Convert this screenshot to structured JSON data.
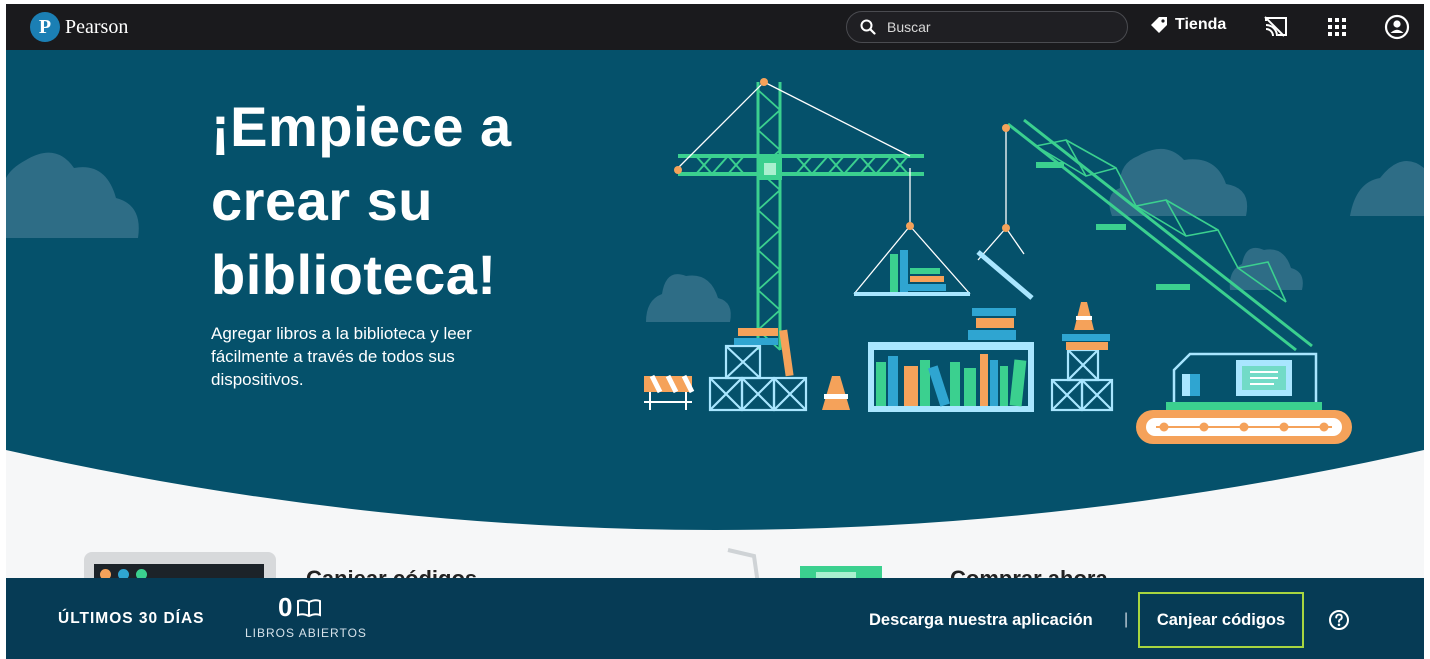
{
  "brand": {
    "logo_letter": "P",
    "name": "Pearson"
  },
  "header": {
    "search_placeholder": "Buscar",
    "store_label": "Tienda",
    "icons": [
      "search-icon",
      "tag-icon",
      "cast-off-icon",
      "apps-grid-icon",
      "account-icon"
    ]
  },
  "hero": {
    "title": "¡Empiece a crear su biblioteca!",
    "subtitle": "Agregar libros a la biblioteca y leer fácilmente a través de todos sus dispositivos."
  },
  "cards": [
    {
      "title": "Canjear códigos"
    },
    {
      "title": "Comprar ahora"
    }
  ],
  "footer": {
    "period_label": "ÚLTIMOS 30 DÍAS",
    "books_open_count": "0",
    "books_open_label": "LIBROS ABIERTOS",
    "app_link": "Descarga nuestra aplicación",
    "separator": "|",
    "redeem_link": "Canjear códigos",
    "help_icon": "help-circle-icon"
  },
  "colors": {
    "topbar": "#1a1a1d",
    "hero_bg": "#05516b",
    "footer_bg": "#063b55",
    "crane_green": "#3bd08f",
    "accent_orange": "#f5a25a",
    "focus_outline": "#a8d540"
  }
}
